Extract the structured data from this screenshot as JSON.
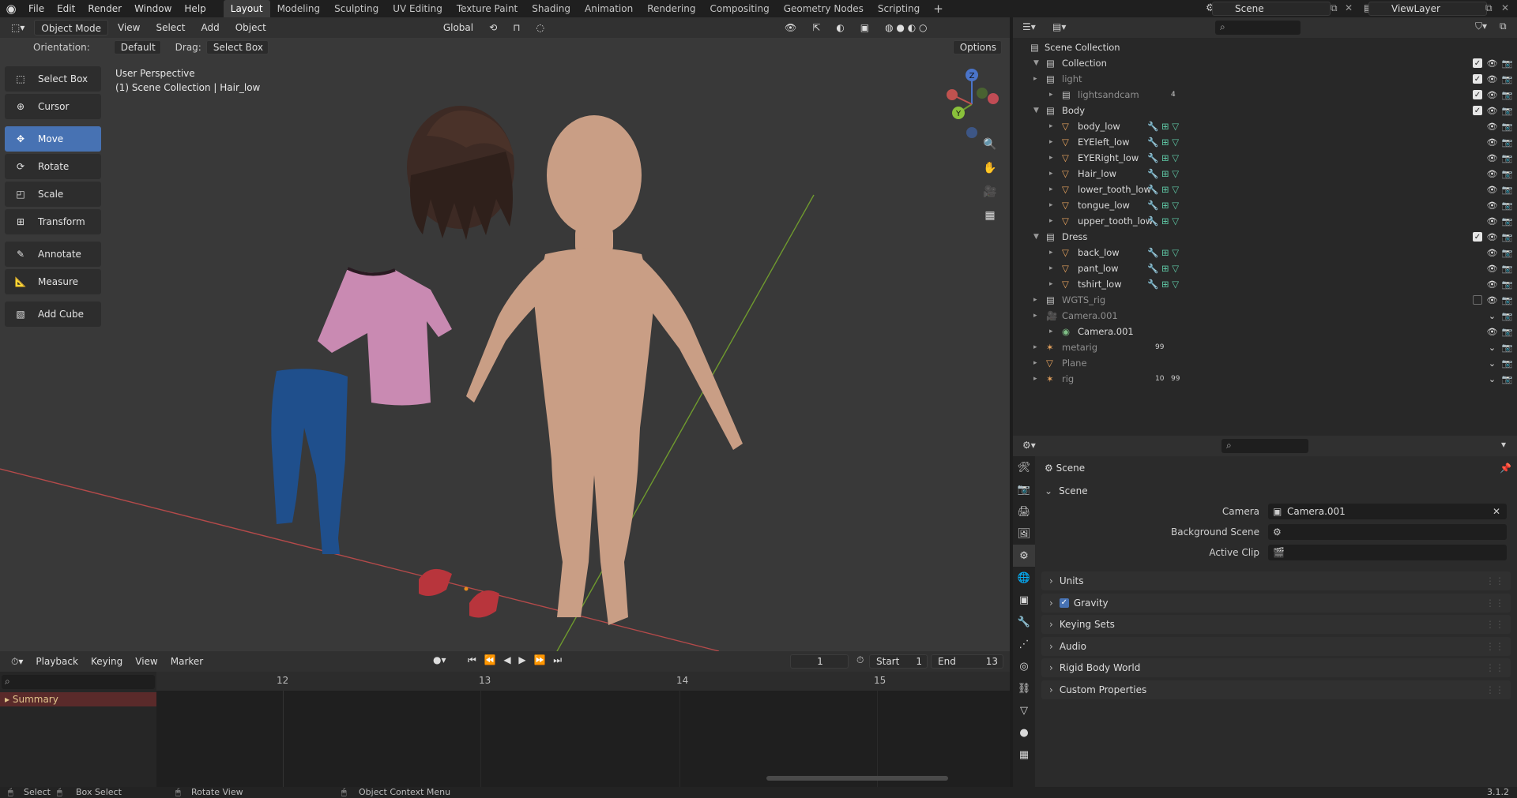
{
  "menu": {
    "items": [
      "File",
      "Edit",
      "Render",
      "Window",
      "Help"
    ],
    "workspaces": [
      "Layout",
      "Modeling",
      "Sculpting",
      "UV Editing",
      "Texture Paint",
      "Shading",
      "Animation",
      "Rendering",
      "Compositing",
      "Geometry Nodes",
      "Scripting"
    ],
    "active_workspace": "Layout",
    "scene": "Scene",
    "view_layer": "ViewLayer"
  },
  "viewport": {
    "mode": "Object Mode",
    "menus": [
      "View",
      "Select",
      "Add",
      "Object"
    ],
    "transform_orientation": "Global",
    "orientation_label": "Orientation:",
    "orientation_value": "Default",
    "drag_label": "Drag:",
    "drag_value": "Select Box",
    "options": "Options",
    "perspective": "User Perspective",
    "context": "(1) Scene Collection | Hair_low",
    "tools": [
      "Select Box",
      "Cursor",
      "Move",
      "Rotate",
      "Scale",
      "Transform",
      "Annotate",
      "Measure",
      "Add Cube"
    ],
    "active_tool": "Move",
    "gizmo": {
      "z": "Z",
      "y": "Y"
    },
    "colors": {
      "bg": "#393939",
      "accent": "#4772b3",
      "x_axis": "#c0524f",
      "y_axis": "#6f9a2e"
    }
  },
  "outliner": {
    "root": "Scene Collection",
    "rows": [
      {
        "name": "Collection",
        "indent": 0,
        "dim": false,
        "type": "collection"
      },
      {
        "name": "light",
        "indent": 0,
        "dim": true,
        "type": "collection"
      },
      {
        "name": "lightsandcam",
        "indent": 1,
        "dim": true,
        "type": "collection",
        "badge": "4"
      },
      {
        "name": "Body",
        "indent": 0,
        "dim": false,
        "type": "collection"
      },
      {
        "name": "body_low",
        "indent": 1,
        "dim": false,
        "type": "mesh"
      },
      {
        "name": "EYEleft_low",
        "indent": 1,
        "dim": false,
        "type": "mesh"
      },
      {
        "name": "EYERight_low",
        "indent": 1,
        "dim": false,
        "type": "mesh"
      },
      {
        "name": "Hair_low",
        "indent": 1,
        "dim": false,
        "type": "mesh"
      },
      {
        "name": "lower_tooth_low",
        "indent": 1,
        "dim": false,
        "type": "mesh"
      },
      {
        "name": "tongue_low",
        "indent": 1,
        "dim": false,
        "type": "mesh"
      },
      {
        "name": "upper_tooth_low",
        "indent": 1,
        "dim": false,
        "type": "mesh"
      },
      {
        "name": "Dress",
        "indent": 0,
        "dim": false,
        "type": "collection"
      },
      {
        "name": "back_low",
        "indent": 1,
        "dim": false,
        "type": "mesh"
      },
      {
        "name": "pant_low",
        "indent": 1,
        "dim": false,
        "type": "mesh"
      },
      {
        "name": "tshirt_low",
        "indent": 1,
        "dim": false,
        "type": "mesh"
      },
      {
        "name": "WGTS_rig",
        "indent": 0,
        "dim": true,
        "type": "collection"
      },
      {
        "name": "Camera.001",
        "indent": 0,
        "dim": true,
        "type": "camera"
      },
      {
        "name": "Camera.001",
        "indent": 1,
        "dim": false,
        "type": "camera-data"
      },
      {
        "name": "metarig",
        "indent": 0,
        "dim": true,
        "type": "armature",
        "badge": "99"
      },
      {
        "name": "Plane",
        "indent": 0,
        "dim": true,
        "type": "mesh"
      },
      {
        "name": "rig",
        "indent": 0,
        "dim": true,
        "type": "armature",
        "badge": "10",
        "badge2": "99"
      }
    ]
  },
  "properties": {
    "context": "Scene",
    "panel": "Scene",
    "camera_label": "Camera",
    "camera_value": "Camera.001",
    "background_label": "Background Scene",
    "active_clip_label": "Active Clip",
    "sections": [
      "Units",
      "Gravity",
      "Keying Sets",
      "Audio",
      "Rigid Body World",
      "Custom Properties"
    ]
  },
  "timeline": {
    "menus": [
      "Playback",
      "Keying",
      "View",
      "Marker"
    ],
    "current_frame": "1",
    "start_label": "Start",
    "start": "1",
    "end_label": "End",
    "end": "13",
    "ruler": [
      "12",
      "13",
      "14",
      "15"
    ],
    "summary": "Summary"
  },
  "status": {
    "select": "Select",
    "box_select": "Box Select",
    "rotate_view": "Rotate View",
    "context_menu": "Object Context Menu",
    "version": "3.1.2"
  }
}
